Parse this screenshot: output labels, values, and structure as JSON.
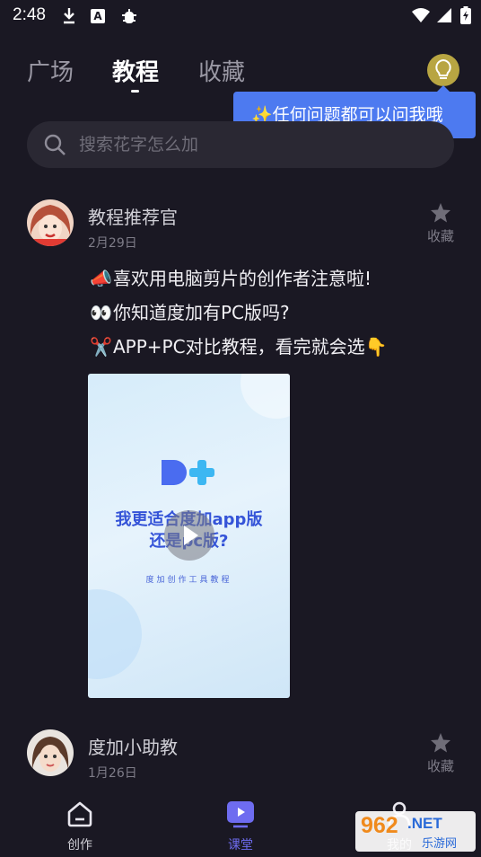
{
  "status_bar": {
    "time": "2:48"
  },
  "tabs": [
    {
      "label": "广场"
    },
    {
      "label": "教程",
      "active": true
    },
    {
      "label": "收藏"
    }
  ],
  "tooltip": {
    "text": "✨任何问题都可以问我哦"
  },
  "search": {
    "placeholder": "搜索花字怎么加",
    "value": ""
  },
  "posts": [
    {
      "author": "教程推荐官",
      "date": "2月29日",
      "fav_label": "收藏",
      "lines": [
        {
          "emoji": "📣",
          "text": "喜欢用电脑剪片的创作者注意啦!"
        },
        {
          "emoji": "👀",
          "text": "你知道度加有PC版吗?"
        },
        {
          "emoji": "✂️",
          "text": "APP+PC对比教程，看完就会选👇"
        }
      ],
      "video": {
        "title_line1": "我更适合度加app版",
        "title_line2": "还是pc版?",
        "subtitle": "度加创作工具教程"
      }
    },
    {
      "author": "度加小助教",
      "date": "1月26日",
      "fav_label": "收藏"
    }
  ],
  "bottom_nav": [
    {
      "label": "创作",
      "icon": "home-icon"
    },
    {
      "label": "课堂",
      "icon": "play-screen-icon",
      "active": true
    },
    {
      "label": "我的",
      "icon": "user-icon"
    }
  ],
  "watermark": {
    "num": "962",
    "net": ".NET",
    "cn": "乐游网"
  },
  "colors": {
    "background": "#1a1823",
    "accent": "#6e6cf0",
    "tooltip": "#4d7af0",
    "bulb": "#b8a542"
  }
}
